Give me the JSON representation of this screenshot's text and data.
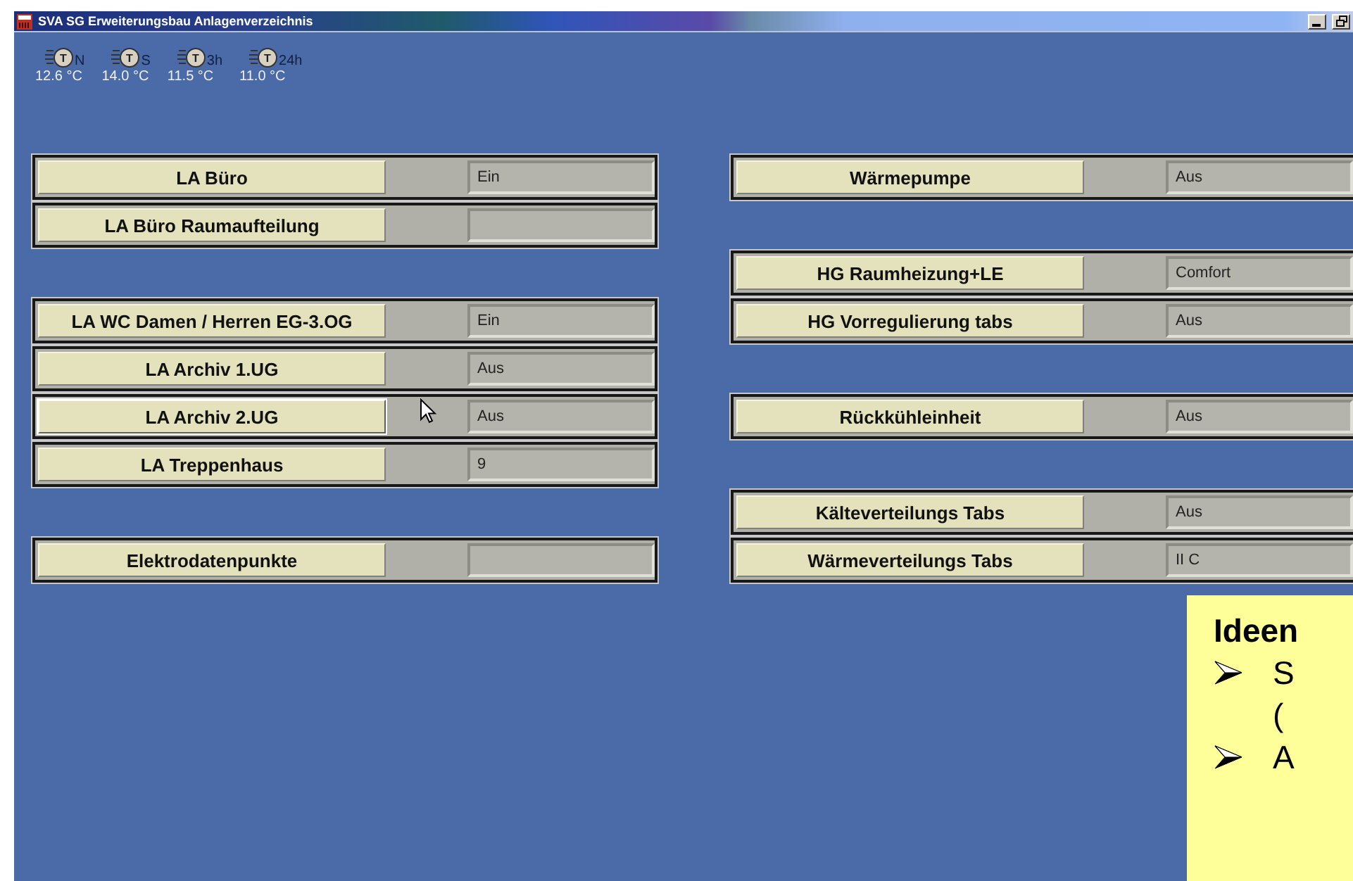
{
  "window": {
    "title": "SVA SG Erweiterungsbau Anlagenverzeichnis"
  },
  "sensors": [
    {
      "symbol": "T",
      "label": "N",
      "value": "12.6 °C"
    },
    {
      "symbol": "T",
      "label": "S",
      "value": "14.0 °C"
    },
    {
      "symbol": "T",
      "label": "3h",
      "value": "11.5 °C"
    },
    {
      "symbol": "T",
      "label": "24h",
      "value": "11.0 °C"
    }
  ],
  "columns": [
    {
      "groups": [
        [
          {
            "label": "LA Büro",
            "value": "Ein",
            "focused": false
          },
          {
            "label": "LA Büro Raumaufteilung",
            "focused": false
          }
        ],
        [
          {
            "label": "LA WC Damen / Herren EG-3.OG",
            "value": "Ein",
            "focused": false
          },
          {
            "label": "LA Archiv 1.UG",
            "value": "Aus",
            "focused": false
          },
          {
            "label": "LA Archiv 2.UG",
            "value": "Aus",
            "focused": true
          },
          {
            "label": "LA Treppenhaus",
            "value": "9",
            "focused": false
          }
        ],
        [
          {
            "label": "Elektrodatenpunkte",
            "focused": false
          }
        ]
      ]
    },
    {
      "groups": [
        [
          {
            "label": "Wärmepumpe",
            "value": "Aus",
            "focused": false
          }
        ],
        [
          {
            "label": "HG Raumheizung+LE",
            "value": "Comfort",
            "focused": false
          },
          {
            "label": "HG Vorregulierung tabs",
            "value": "Aus",
            "focused": false
          }
        ],
        [
          {
            "label": "Rückkühleinheit",
            "value": "Aus",
            "focused": false
          }
        ],
        [
          {
            "label": "Kälteverteilungs Tabs",
            "value": "Aus",
            "focused": false
          },
          {
            "label": "Wärmeverteilungs Tabs",
            "value": "II C",
            "focused": false
          }
        ]
      ]
    }
  ],
  "note": {
    "title": "Ideen",
    "bullets": [
      {
        "lines": [
          "S",
          "("
        ]
      },
      {
        "lines": [
          "A"
        ]
      }
    ]
  }
}
